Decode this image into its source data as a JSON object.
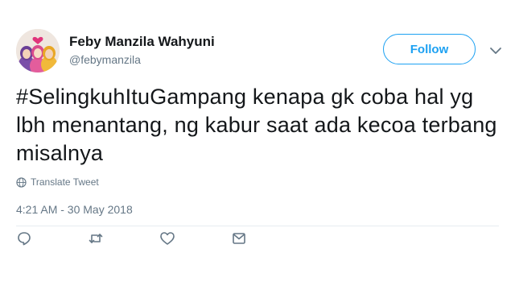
{
  "tweet": {
    "author_name": "Feby Manzila Wahyuni",
    "author_handle": "@febymanzila",
    "follow_label": "Follow",
    "hashtag": "#SelingkuhItuGampang",
    "text_rest": " kenapa gk coba hal yg lbh menantang, ng kabur saat ada kecoa terbang misalnya",
    "translate_label": "Translate Tweet",
    "timestamp": "4:21 AM - 30 May 2018"
  },
  "colors": {
    "accent": "#1da1f2",
    "text": "#14171a",
    "secondary": "#657786",
    "divider": "#e6ecf0"
  },
  "icons": {
    "caret": "chevron-down-icon",
    "translate": "globe-icon",
    "reply": "reply-icon",
    "retweet": "retweet-icon",
    "like": "heart-icon",
    "message": "envelope-icon"
  }
}
